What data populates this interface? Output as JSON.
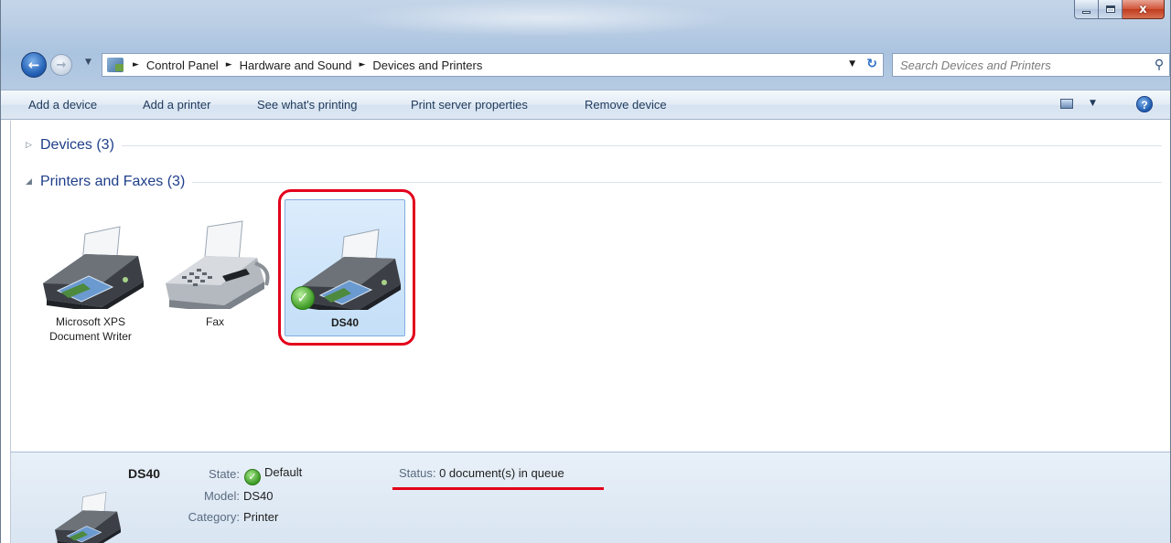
{
  "window": {
    "min_label": "–",
    "max_label": "□",
    "close_label": "x"
  },
  "nav": {
    "back_glyph": "←",
    "forward_glyph": "→",
    "recent_glyph": "▼",
    "breadcrumbs": [
      "Control Panel",
      "Hardware and Sound",
      "Devices and Printers"
    ],
    "separator": "►",
    "address_drop": "▼",
    "refresh_glyph": "↻",
    "search_placeholder": "Search Devices and Printers",
    "search_glyph": "⚲"
  },
  "toolbar": {
    "commands": [
      "Add a device",
      "Add a printer",
      "See what's printing",
      "Print server properties",
      "Remove device"
    ],
    "view_drop": "▼",
    "help_label": "?"
  },
  "groups": [
    {
      "title": "Devices (3)",
      "expanded": false,
      "toggle": "▷"
    },
    {
      "title": "Printers and Faxes (3)",
      "expanded": true,
      "toggle": "◢"
    }
  ],
  "printers": [
    {
      "name": "Microsoft XPS Document Writer",
      "line1": "Microsoft XPS",
      "line2": "Document Writer",
      "icon": "printer-icon",
      "selected": false,
      "default": false
    },
    {
      "name": "Fax",
      "line1": "Fax",
      "line2": "",
      "icon": "fax-icon",
      "selected": false,
      "default": false
    },
    {
      "name": "DS40",
      "line1": "DS40",
      "line2": "",
      "icon": "printer-icon",
      "selected": true,
      "default": true
    }
  ],
  "details": {
    "name": "DS40",
    "state_key": "State:",
    "state_value": "Default",
    "model_key": "Model:",
    "model_value": "DS40",
    "category_key": "Category:",
    "category_value": "Printer",
    "status_key": "Status:",
    "status_value": "0 document(s) in queue",
    "check_glyph": "✓"
  },
  "colors": {
    "accent_red": "#e3001b",
    "link_blue": "#1e3f8a",
    "selection": "#c4dff8"
  }
}
